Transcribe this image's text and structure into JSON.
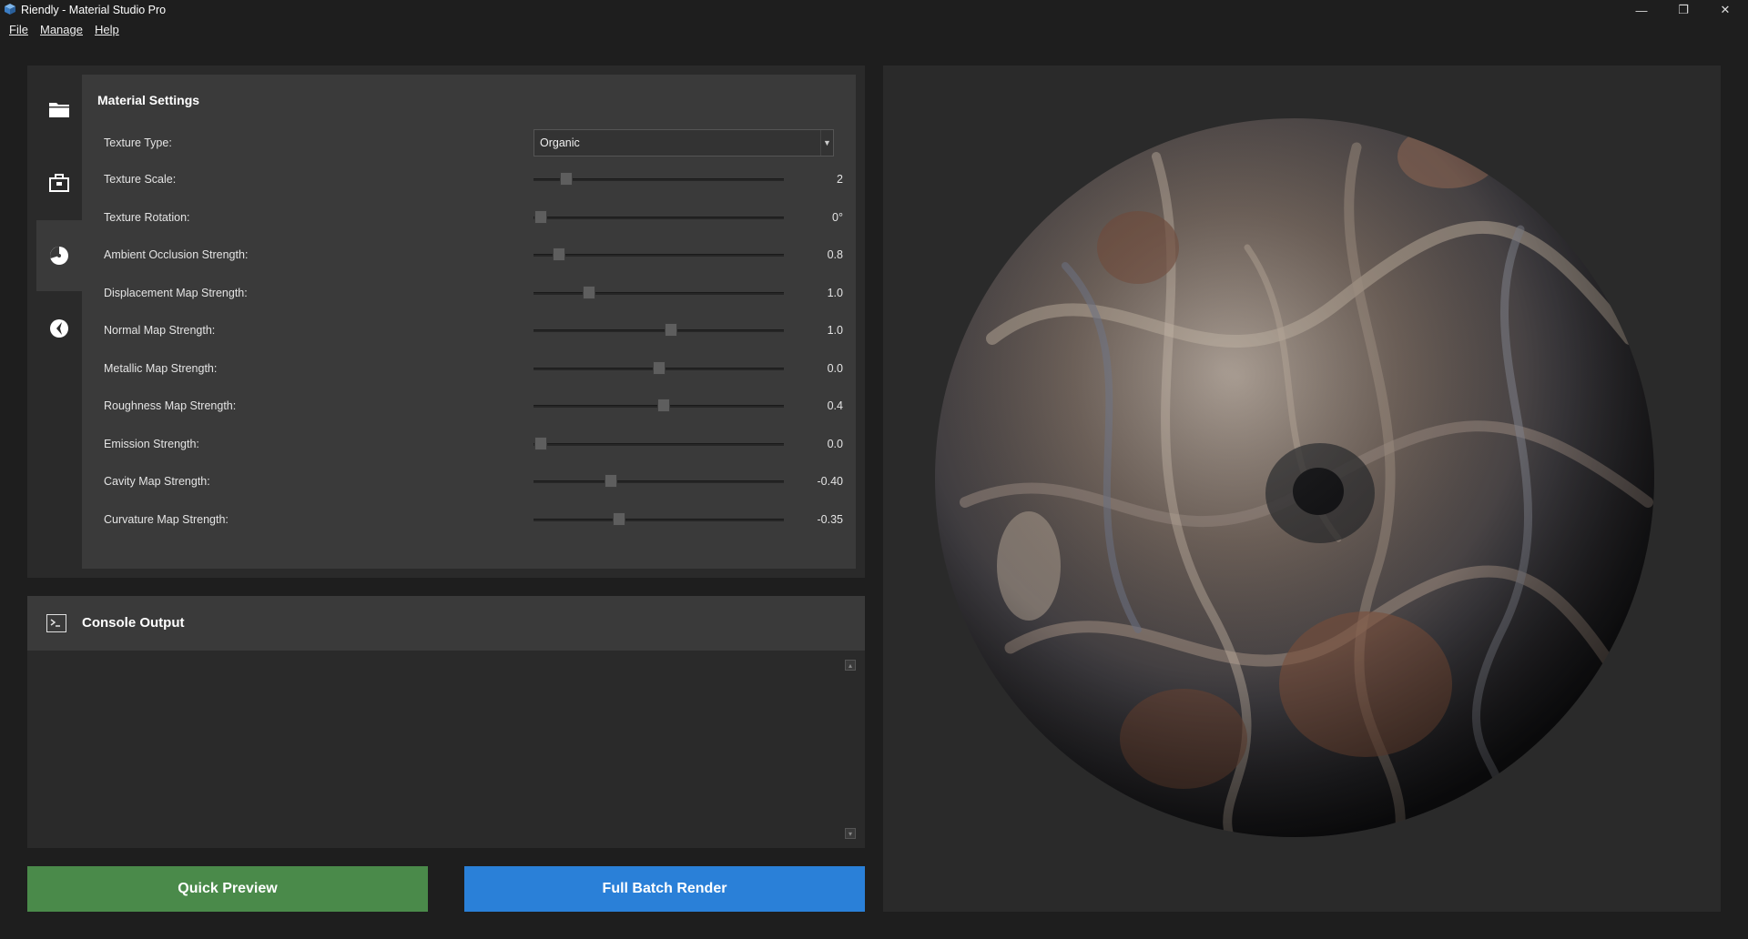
{
  "window": {
    "title": "Riendly - Material Studio Pro",
    "controls": {
      "minimize": "—",
      "restore": "❐",
      "close": "✕"
    }
  },
  "menu": [
    {
      "label": "File"
    },
    {
      "label": "Manage"
    },
    {
      "label": "Help"
    }
  ],
  "side_tabs": [
    {
      "icon": "folder-icon"
    },
    {
      "icon": "briefcase-icon"
    },
    {
      "icon": "material-sphere-icon",
      "active": true
    },
    {
      "icon": "compass-icon"
    }
  ],
  "settings": {
    "title": "Material Settings",
    "texture_type": {
      "label": "Texture Type:",
      "value": "Organic"
    },
    "sliders": [
      {
        "label": "Texture Scale:",
        "value": "2",
        "level": 0.13
      },
      {
        "label": "Texture Rotation:",
        "value": "0°",
        "level": 0.03
      },
      {
        "label": "Ambient Occlusion Strength:",
        "value": "0.8",
        "level": 0.1
      },
      {
        "label": "Displacement Map Strength:",
        "value": "1.0",
        "level": 0.22
      },
      {
        "label": "Normal Map Strength:",
        "value": "1.0",
        "level": 0.55
      },
      {
        "label": "Metallic Map Strength:",
        "value": "0.0",
        "level": 0.5
      },
      {
        "label": "Roughness Map Strength:",
        "value": "0.4",
        "level": 0.52
      },
      {
        "label": "Emission Strength:",
        "value": "0.0",
        "level": 0.03
      },
      {
        "label": "Cavity Map Strength:",
        "value": "-0.40",
        "level": 0.31
      },
      {
        "label": "Curvature Map Strength:",
        "value": "-0.35",
        "level": 0.34
      }
    ]
  },
  "console": {
    "title": "Console Output",
    "content": ""
  },
  "buttons": {
    "quick_preview": "Quick Preview",
    "full_batch_render": "Full Batch Render"
  },
  "colors": {
    "preview_button": "#4a8a4a",
    "render_button": "#2a80d8",
    "app_icon": "#4a90d9"
  }
}
